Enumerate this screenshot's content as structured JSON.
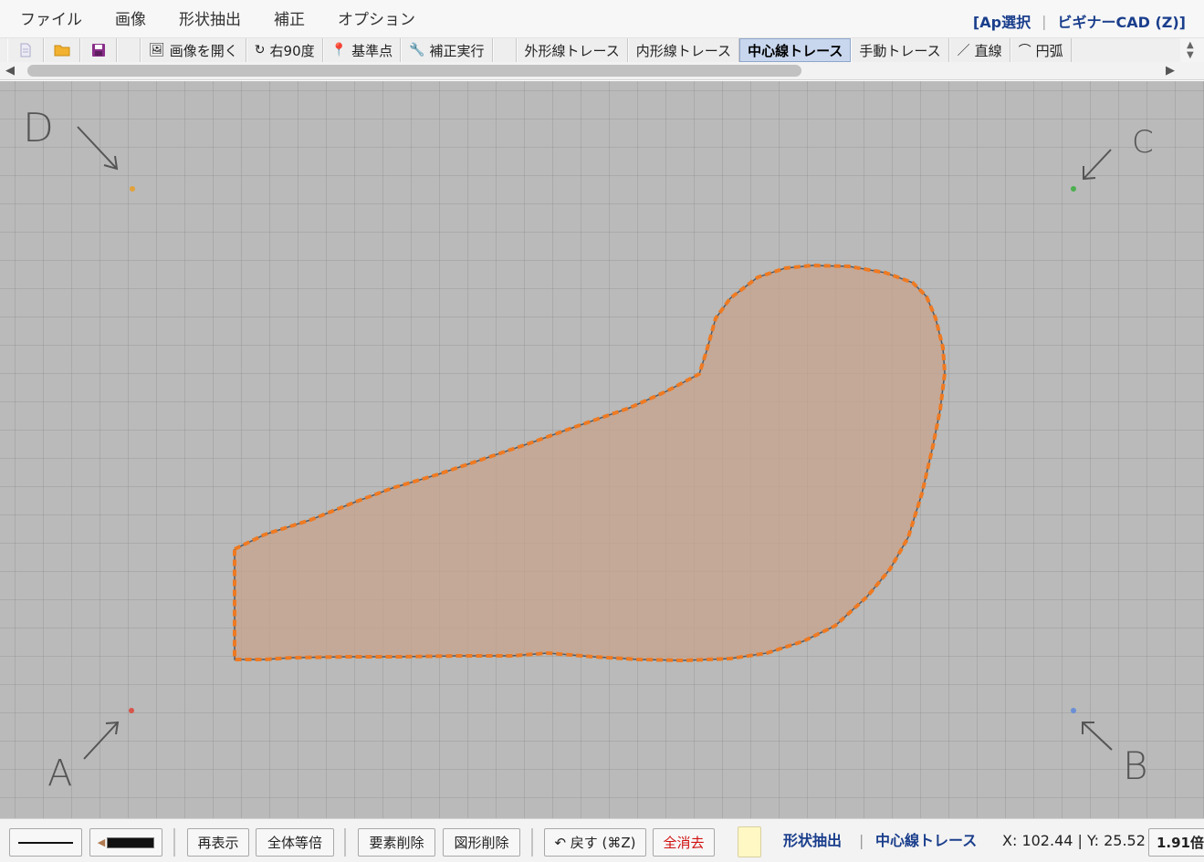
{
  "menubar": {
    "items": [
      "ファイル",
      "画像",
      "形状抽出",
      "補正",
      "オプション"
    ],
    "right_mode": "[Ap選択",
    "right_sep": "|",
    "right_cad": "ビギナーCAD (Z)]"
  },
  "toolbar": {
    "open_image": "画像を開く",
    "rotate_right": "右90度",
    "reference_point": "基準点",
    "run_correction": "補正実行",
    "outer_trace": "外形線トレース",
    "inner_trace": "内形線トレース",
    "center_trace": "中心線トレース",
    "manual_trace": "手動トレース",
    "line": "直線",
    "arc": "円弧"
  },
  "canvas": {
    "corner_labels": {
      "a": "A",
      "b": "B",
      "c": "C",
      "d": "D"
    },
    "colors": {
      "marker_a": "#d8554b",
      "marker_b": "#6a8fd6",
      "marker_c": "#4caf50",
      "marker_d": "#e3a13a",
      "shape_fill": "#c9a38a",
      "outline": "#ef7a22"
    }
  },
  "bottombar": {
    "redisplay": "再表示",
    "fit_all": "全体等倍",
    "delete_element": "要素削除",
    "delete_shape": "図形削除",
    "undo": "↶ 戻す (⌘Z)",
    "clear_all": "全消去",
    "mode": "形状抽出",
    "mode_sep": "|",
    "submode": "中心線トレース",
    "coords": "X: 102.44 | Y: 25.52",
    "zoom": "1.91倍"
  }
}
